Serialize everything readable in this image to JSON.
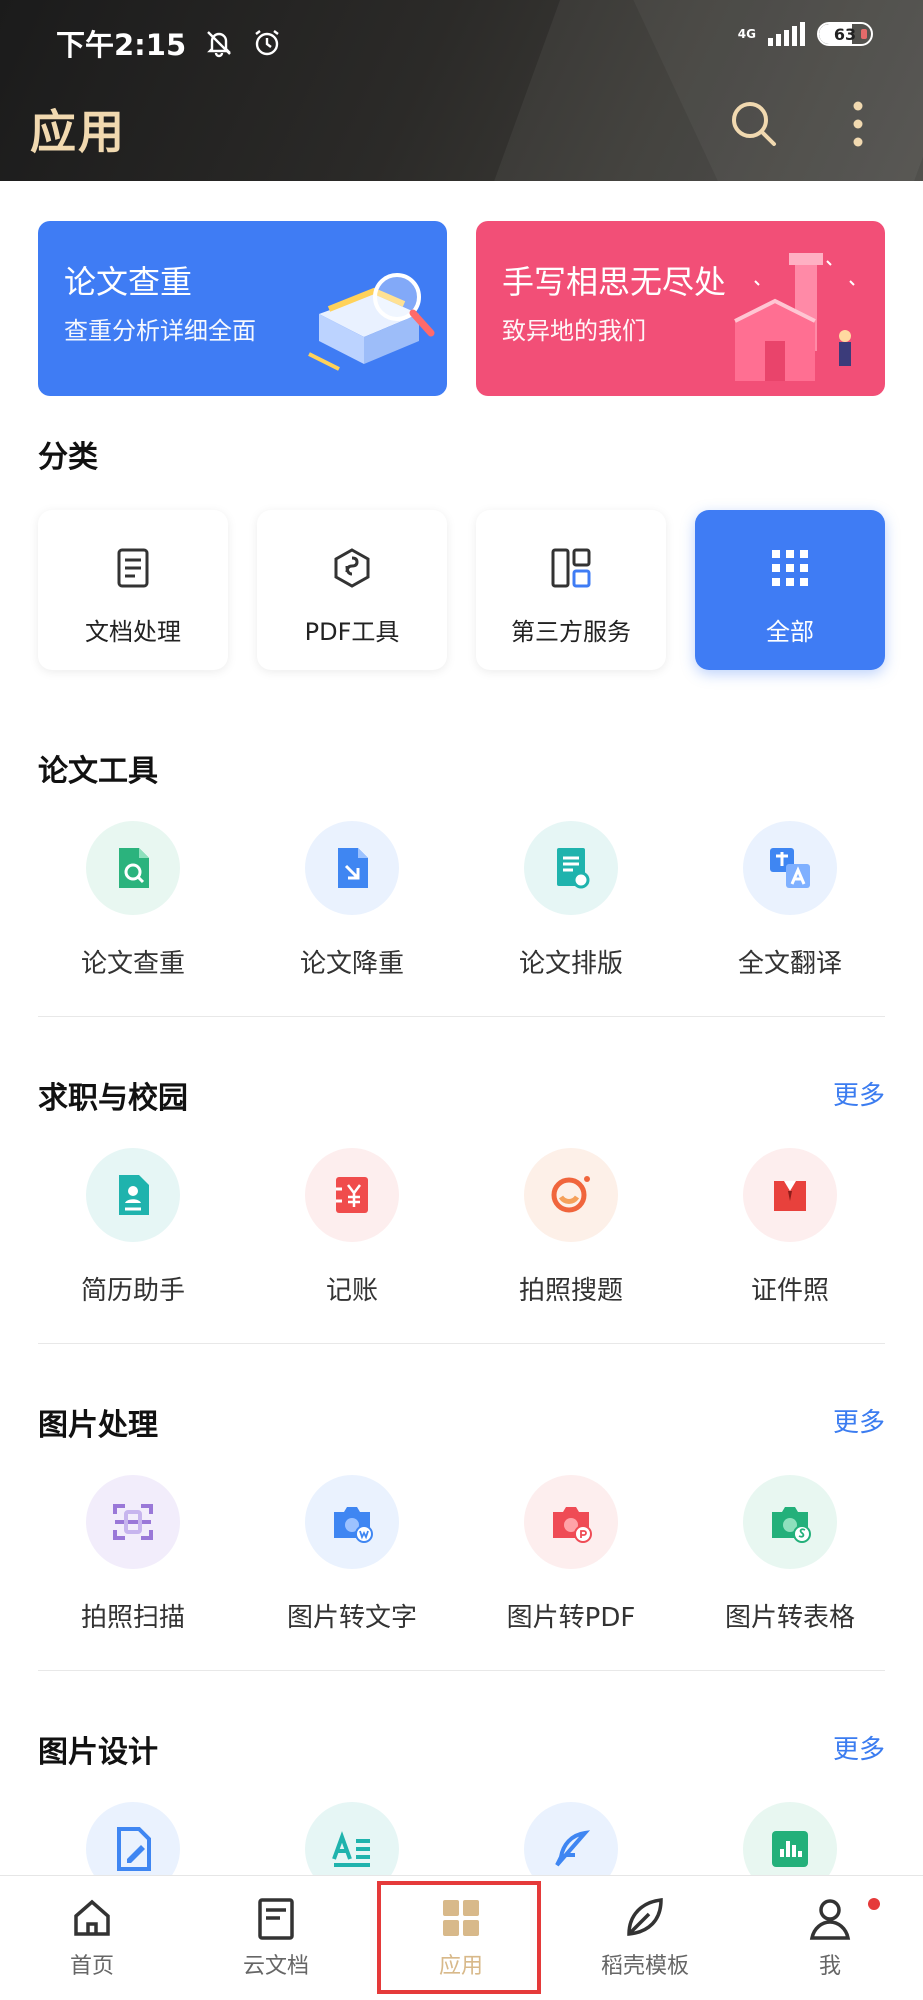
{
  "status_bar": {
    "time": "下午2:15",
    "network": "4G",
    "battery": "63",
    "battery_level": 0.63
  },
  "header": {
    "title": "应用"
  },
  "banners": [
    {
      "title": "论文查重",
      "subtitle": "查重分析详细全面",
      "color": "#3f7cf4"
    },
    {
      "title": "手写相思无尽处",
      "subtitle": "致异地的我们",
      "color": "#f24f77"
    }
  ],
  "categories": {
    "title": "分类",
    "items": [
      {
        "label": "文档处理",
        "icon": "document-icon"
      },
      {
        "label": "PDF工具",
        "icon": "pdf-hexagon-icon"
      },
      {
        "label": "第三方服务",
        "icon": "layout-grid-icon"
      },
      {
        "label": "全部",
        "icon": "dots-grid-icon",
        "active": true
      }
    ]
  },
  "sections": [
    {
      "title": "论文工具",
      "more": "",
      "items": [
        {
          "label": "论文查重",
          "icon": "paper-check-icon"
        },
        {
          "label": "论文降重",
          "icon": "paper-reduce-icon"
        },
        {
          "label": "论文排版",
          "icon": "paper-format-icon"
        },
        {
          "label": "全文翻译",
          "icon": "translate-icon"
        }
      ]
    },
    {
      "title": "求职与校园",
      "more": "更多",
      "items": [
        {
          "label": "简历助手",
          "icon": "resume-icon"
        },
        {
          "label": "记账",
          "icon": "ledger-icon"
        },
        {
          "label": "拍照搜题",
          "icon": "photo-search-icon"
        },
        {
          "label": "证件照",
          "icon": "id-photo-icon"
        }
      ]
    },
    {
      "title": "图片处理",
      "more": "更多",
      "items": [
        {
          "label": "拍照扫描",
          "icon": "scan-icon"
        },
        {
          "label": "图片转文字",
          "icon": "image-to-text-icon"
        },
        {
          "label": "图片转PDF",
          "icon": "image-to-pdf-icon"
        },
        {
          "label": "图片转表格",
          "icon": "image-to-sheet-icon"
        }
      ]
    },
    {
      "title": "图片设计",
      "more": "更多",
      "items": [
        {
          "label": "",
          "icon": "design-edit-icon"
        },
        {
          "label": "",
          "icon": "text-design-icon"
        },
        {
          "label": "",
          "icon": "feather-icon"
        },
        {
          "label": "",
          "icon": "chart-design-icon"
        }
      ]
    }
  ],
  "tabbar": {
    "items": [
      {
        "label": "首页",
        "icon": "home-icon"
      },
      {
        "label": "云文档",
        "icon": "cloud-doc-icon"
      },
      {
        "label": "应用",
        "icon": "apps-icon",
        "active": true
      },
      {
        "label": "稻壳模板",
        "icon": "leaf-icon"
      },
      {
        "label": "我",
        "icon": "user-icon"
      }
    ]
  }
}
